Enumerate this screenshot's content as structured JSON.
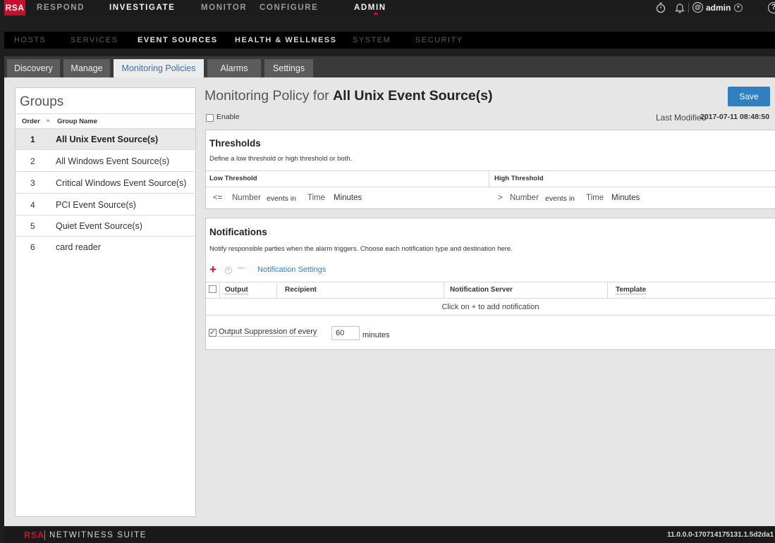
{
  "topnav": {
    "logo": "RSA",
    "items": [
      {
        "label": "RESPOND"
      },
      {
        "label": "INVESTIGATE"
      },
      {
        "label": "MONITOR"
      },
      {
        "label": "CONFIGURE"
      },
      {
        "label": "ADMIN"
      }
    ],
    "user": {
      "initial": "@",
      "name": "admin"
    },
    "help": "?",
    "icons": [
      "stopwatch-icon",
      "bell-icon",
      "user-icon",
      "chevron-down-icon",
      "help-icon"
    ]
  },
  "subnav": {
    "items": [
      {
        "label": "HOSTS"
      },
      {
        "label": "SERVICES"
      },
      {
        "label": "EVENT SOURCES"
      },
      {
        "label": "HEALTH & WELLNESS"
      },
      {
        "label": "SYSTEM"
      },
      {
        "label": "SECURITY"
      }
    ]
  },
  "tabs": [
    {
      "label": "Discovery"
    },
    {
      "label": "Manage"
    },
    {
      "label": "Monitoring Policies"
    },
    {
      "label": "Alarms"
    },
    {
      "label": "Settings"
    }
  ],
  "groups": {
    "title": "Groups",
    "col_order": "Order",
    "col_order_sort": "^",
    "col_name": "Group Name",
    "rows": [
      {
        "order": "1",
        "name": "All Unix Event Source(s)"
      },
      {
        "order": "2",
        "name": "All Windows Event Source(s)"
      },
      {
        "order": "3",
        "name": "Critical Windows Event Source(s)"
      },
      {
        "order": "4",
        "name": "PCI Event Source(s)"
      },
      {
        "order": "5",
        "name": "Quiet Event Source(s)"
      },
      {
        "order": "6",
        "name": "card reader"
      }
    ]
  },
  "policy": {
    "title_prefix": "Monitoring Policy for",
    "title_group": "All Unix Event Source(s)",
    "save_label": "Save",
    "enable_label": "Enable",
    "last_modified_label": "Last Modified",
    "last_modified_value": "2017-07-11 08:48:50"
  },
  "thresholds": {
    "title": "Thresholds",
    "description": "Define a low threshold or high threshold or both.",
    "low_header": "Low Threshold",
    "high_header": "High Threshold",
    "low": {
      "op": "<=",
      "number": "Number",
      "events_in": "events in",
      "time": "Time",
      "unit": "Minutes"
    },
    "high": {
      "op": ">",
      "number": "Number",
      "events_in": "events in",
      "time": "Time",
      "unit": "Minutes"
    }
  },
  "notifications": {
    "title": "Notifications",
    "description": "Notify responsible parties when the alarm triggers. Choose each notification type and destination here.",
    "settings_link": "Notification Settings",
    "plus": "+",
    "chevron": "v",
    "minus": "−",
    "columns": [
      "Output",
      "Recipient",
      "Notification Server",
      "Template"
    ],
    "empty_message": "Click on + to add notification",
    "suppression_check": "✓",
    "suppression_label": "Output Suppression of every",
    "suppression_value": "60",
    "suppression_units": "minutes"
  },
  "footer": {
    "brand": "RSA",
    "product": "NETWITNESS SUITE",
    "version": "11.0.0.0-170714175131.1.5d2da1"
  },
  "colors": {
    "brand_red": "#c8102e",
    "accent_blue": "#2e80c3",
    "link_blue": "#3b7dbf"
  }
}
